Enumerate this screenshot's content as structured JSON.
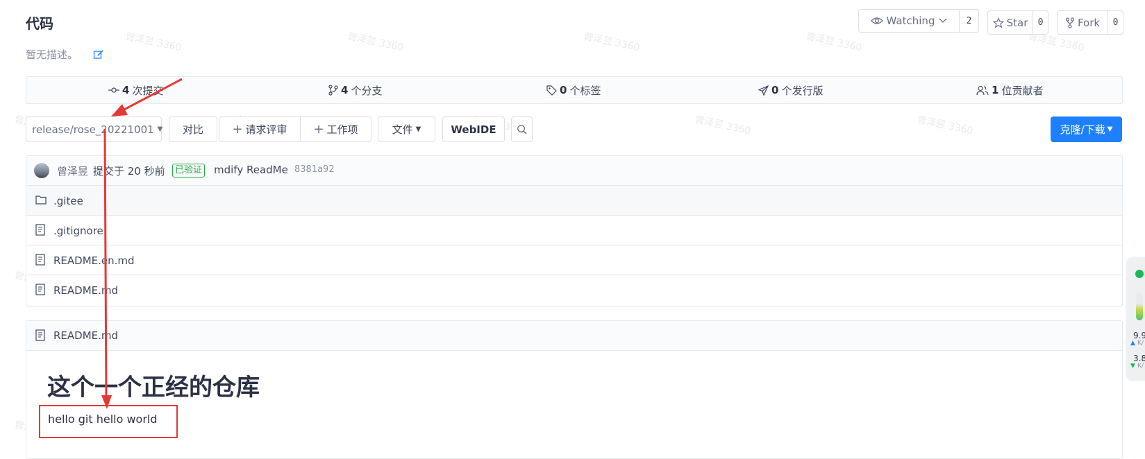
{
  "header": {
    "title": "代码",
    "description": "暂无描述。"
  },
  "actions": {
    "watching_label": "Watching",
    "watching_count": "2",
    "star_label": "Star",
    "star_count": "0",
    "fork_label": "Fork",
    "fork_count": "0"
  },
  "stats": {
    "commits": {
      "count": "4",
      "label": "次提交"
    },
    "branches": {
      "count": "4",
      "label": "个分支"
    },
    "tags": {
      "count": "0",
      "label": "个标签"
    },
    "releases": {
      "count": "0",
      "label": "个发行版"
    },
    "contributors": {
      "count": "1",
      "label": "位贡献者"
    }
  },
  "toolbar": {
    "branch": "release/rose_20221001",
    "compare": "对比",
    "pull_request": "请求评审",
    "work_item": "工作项",
    "file": "文件",
    "webide": "WebIDE",
    "clone": "克隆/下载"
  },
  "commit": {
    "author": "曾泽昱",
    "time": "提交于 20 秒前",
    "verified": "已验证",
    "message": "mdify ReadMe",
    "hash": "8381a92"
  },
  "files": [
    {
      "name": ".gitee",
      "icon": "folder-icon"
    },
    {
      "name": ".gitignore",
      "icon": "file-icon"
    },
    {
      "name": "README.en.md",
      "icon": "file-icon"
    },
    {
      "name": "README.md",
      "icon": "file-icon"
    }
  ],
  "readme": {
    "filename": "README.md",
    "heading": "这个一个正经的仓库",
    "body": "hello git hello world"
  },
  "watermark": "曾泽昱 3360",
  "side_widget": {
    "upload": "9.9",
    "upload_unit": "K/",
    "download": "3.8",
    "download_unit": "K/"
  },
  "colors": {
    "accent": "#1e80ff",
    "verified": "#28a745",
    "annotation": "#e53935"
  }
}
